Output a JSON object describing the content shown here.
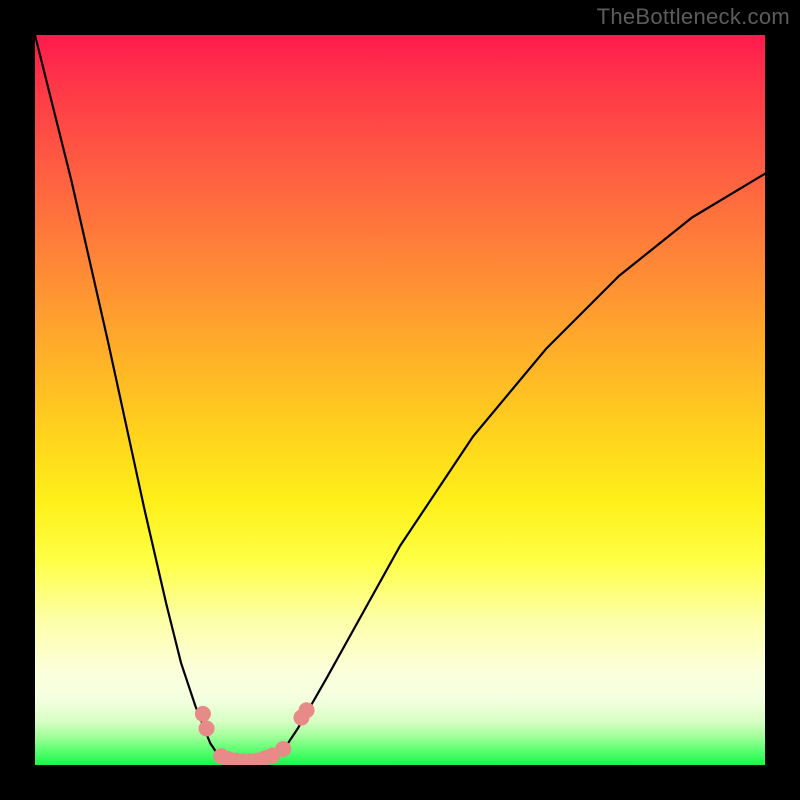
{
  "watermark": "TheBottleneck.com",
  "chart_data": {
    "type": "line",
    "title": "",
    "xlabel": "",
    "ylabel": "",
    "xlim": [
      0,
      100
    ],
    "ylim": [
      0,
      100
    ],
    "x": [
      0,
      5,
      10,
      15,
      18,
      20,
      22,
      24,
      25,
      26,
      27,
      28,
      29,
      30,
      31,
      32,
      34,
      36,
      40,
      50,
      60,
      70,
      80,
      90,
      100
    ],
    "y": [
      100,
      80,
      58,
      35,
      22,
      14,
      8,
      3,
      1.5,
      0.8,
      0.4,
      0.2,
      0.2,
      0.2,
      0.4,
      0.8,
      2,
      5,
      12,
      30,
      45,
      57,
      67,
      75,
      81
    ],
    "markers": [
      {
        "x": 23.0,
        "y": 7.0
      },
      {
        "x": 23.5,
        "y": 5.0
      },
      {
        "x": 25.5,
        "y": 1.2
      },
      {
        "x": 26.5,
        "y": 0.8
      },
      {
        "x": 27.5,
        "y": 0.6
      },
      {
        "x": 28.5,
        "y": 0.5
      },
      {
        "x": 29.5,
        "y": 0.5
      },
      {
        "x": 30.5,
        "y": 0.6
      },
      {
        "x": 31.5,
        "y": 0.9
      },
      {
        "x": 32.5,
        "y": 1.3
      },
      {
        "x": 34.0,
        "y": 2.2
      },
      {
        "x": 36.5,
        "y": 6.5
      },
      {
        "x": 37.2,
        "y": 7.5
      }
    ],
    "background_gradient": {
      "top": "#ff1a4d",
      "mid": "#fef01a",
      "bottom": "#17f74d"
    }
  }
}
